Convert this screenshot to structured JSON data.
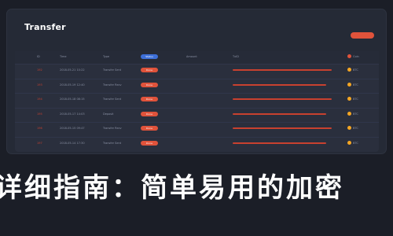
{
  "window": {
    "title": "Transfer"
  },
  "table": {
    "headers": {
      "id": "ID",
      "time": "Time",
      "type": "Type",
      "status": "Status",
      "a": "Amount",
      "b": "TxID",
      "c": "Coin"
    },
    "rows": [
      {
        "id": "192",
        "time": "2018-05-21 10:22",
        "type": "Transfer Sent",
        "status": "Done",
        "coin": "BTC",
        "bar": 0.9,
        "status_color": "#e0533b"
      },
      {
        "id": "193",
        "time": "2018-05-19 12:40",
        "type": "Transfer Recv",
        "status": "Done",
        "coin": "BTC",
        "bar": 0.85,
        "status_color": "#e0533b"
      },
      {
        "id": "194",
        "time": "2018-05-18 08:15",
        "type": "Transfer Sent",
        "status": "Done",
        "coin": "BTC",
        "bar": 0.9,
        "status_color": "#e0533b"
      },
      {
        "id": "195",
        "time": "2018-05-17 14:03",
        "type": "Deposit",
        "status": "Done",
        "coin": "BTC",
        "bar": 0.85,
        "status_color": "#e0533b"
      },
      {
        "id": "196",
        "time": "2018-05-15 09:47",
        "type": "Transfer Recv",
        "status": "Done",
        "coin": "BTC",
        "bar": 0.9,
        "status_color": "#e0533b"
      },
      {
        "id": "197",
        "time": "2018-05-14 17:30",
        "type": "Transfer Sent",
        "status": "Done",
        "coin": "BTC",
        "bar": 0.85,
        "status_color": "#e0533b"
      }
    ]
  },
  "banner": {
    "text": "详细指南：简单易用的加密"
  },
  "colors": {
    "background": "#1b1e27",
    "panel": "#252a36",
    "accent": "#e0533b",
    "coin_dot": "#f5a623"
  }
}
